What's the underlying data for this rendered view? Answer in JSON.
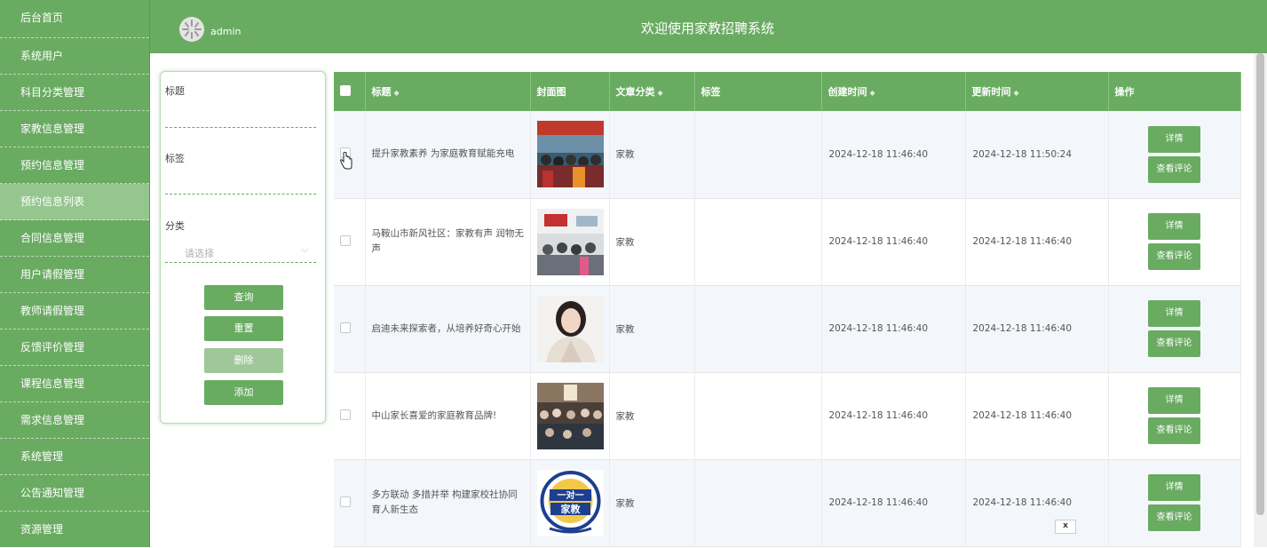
{
  "sidebar": {
    "items": [
      {
        "label": "后台首页"
      },
      {
        "label": "系统用户"
      },
      {
        "label": "科目分类管理"
      },
      {
        "label": "家教信息管理"
      },
      {
        "label": "预约信息管理"
      },
      {
        "label": "预约信息列表"
      },
      {
        "label": "合同信息管理"
      },
      {
        "label": "用户请假管理"
      },
      {
        "label": "教师请假管理"
      },
      {
        "label": "反馈评价管理"
      },
      {
        "label": "课程信息管理"
      },
      {
        "label": "需求信息管理"
      },
      {
        "label": "系统管理"
      },
      {
        "label": "公告通知管理"
      },
      {
        "label": "资源管理"
      }
    ],
    "active_index": 5
  },
  "header": {
    "user": "admin",
    "title": "欢迎使用家教招聘系统"
  },
  "search": {
    "title_label": "标题",
    "tag_label": "标签",
    "category_label": "分类",
    "category_placeholder": "请选择",
    "query_button": "查询",
    "reset_button": "重置",
    "delete_button": "删除",
    "add_button": "添加"
  },
  "table": {
    "columns": {
      "title": "标题",
      "cover": "封面图",
      "category": "文章分类",
      "tags": "标签",
      "created": "创建时间",
      "updated": "更新时间",
      "ops": "操作"
    },
    "rows": [
      {
        "title": "提升家教素养 为家庭教育赋能充电",
        "category": "家教",
        "tags": "",
        "created": "2024-12-18 11:46:40",
        "updated": "2024-12-18 11:50:24"
      },
      {
        "title": "马鞍山市新风社区：家教有声 润物无声",
        "category": "家教",
        "tags": "",
        "created": "2024-12-18 11:46:40",
        "updated": "2024-12-18 11:46:40"
      },
      {
        "title": "启迪未来探索者，从培养好奇心开始",
        "category": "家教",
        "tags": "",
        "created": "2024-12-18 11:46:40",
        "updated": "2024-12-18 11:46:40"
      },
      {
        "title": "中山家长喜爱的家庭教育品牌!",
        "category": "家教",
        "tags": "",
        "created": "2024-12-18 11:46:40",
        "updated": "2024-12-18 11:46:40"
      },
      {
        "title": "多方联动 多措并举 构建家校社协同育人新生态",
        "category": "家教",
        "tags": "",
        "created": "2024-12-18 11:46:40",
        "updated": "2024-12-18 11:46:40"
      }
    ],
    "detail_label": "详情",
    "comment_label": "查看评论"
  },
  "logo_text": {
    "top": "一对一",
    "bottom": "家教"
  },
  "popup": {
    "close_label": "x"
  },
  "colors": {
    "primary": "#6aab62",
    "active": "#95c68e",
    "row_alt": "#f3f6fa"
  }
}
